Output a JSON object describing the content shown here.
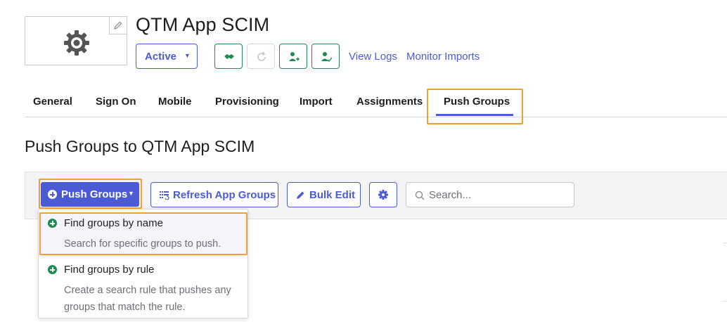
{
  "app": {
    "title": "QTM App SCIM",
    "status_label": "Active",
    "links": {
      "view_logs": "View Logs",
      "monitor_imports": "Monitor Imports"
    }
  },
  "tabs": [
    {
      "label": "General"
    },
    {
      "label": "Sign On"
    },
    {
      "label": "Mobile"
    },
    {
      "label": "Provisioning"
    },
    {
      "label": "Import"
    },
    {
      "label": "Assignments"
    },
    {
      "label": "Push Groups",
      "active": true
    }
  ],
  "section": {
    "title": "Push Groups to QTM App SCIM"
  },
  "toolbar": {
    "push_groups_label": "Push Groups",
    "refresh_label": "Refresh App Groups",
    "bulk_edit_label": "Bulk Edit",
    "search_placeholder": "Search..."
  },
  "dropdown": {
    "items": [
      {
        "title": "Find groups by name",
        "description": "Search for specific groups to push."
      },
      {
        "title": "Find groups by rule",
        "description": "Create a search rule that pushes any groups that match the rule."
      }
    ]
  },
  "colors": {
    "accent": "#4b5bd6",
    "success": "#1f8a52",
    "highlight": "#f0a030"
  },
  "icons": [
    "gear-icon",
    "pencil-icon",
    "handshake-icon",
    "refresh-icon",
    "user-push-icon",
    "user-check-icon",
    "list-refresh-icon",
    "pencil-icon",
    "settings-icon",
    "search-icon",
    "plus-circle-icon"
  ]
}
